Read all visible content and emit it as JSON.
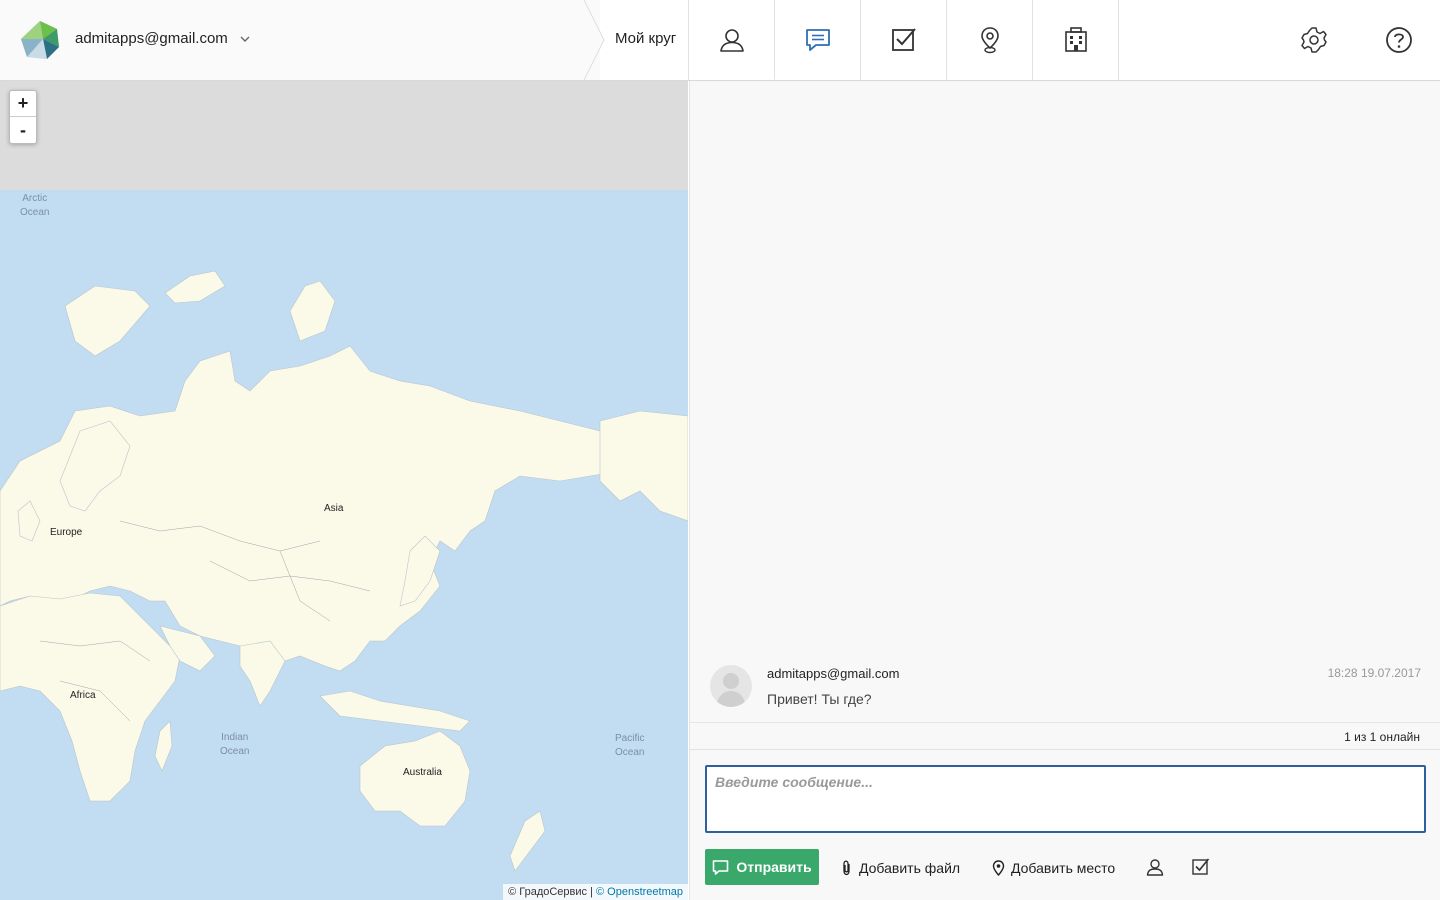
{
  "header": {
    "account_email": "admitapps@gmail.com",
    "breadcrumb": "Мой круг",
    "tabs": [
      {
        "id": "contacts",
        "icon": "user-icon",
        "active": false
      },
      {
        "id": "chat",
        "icon": "chat-icon",
        "active": true
      },
      {
        "id": "tasks",
        "icon": "checkbox-icon",
        "active": false
      },
      {
        "id": "places",
        "icon": "map-pin-icon",
        "active": false
      },
      {
        "id": "organizations",
        "icon": "building-icon",
        "active": false
      }
    ],
    "settings_icon": "gear-icon",
    "help_icon": "help-icon"
  },
  "map": {
    "zoom_in": "+",
    "zoom_out": "-",
    "labels": {
      "asia": "Asia",
      "europe": "Europe",
      "africa": "Africa",
      "australia": "Australia"
    },
    "oceans": {
      "arctic_1": "Arctic",
      "arctic_2": "Ocean",
      "indian_1": "Indian",
      "indian_2": "Ocean",
      "pacific_1": "Pacific",
      "pacific_2": "Ocean"
    },
    "attribution_text": "© ГрадоСервис | ",
    "attribution_link": "© Openstreetmap"
  },
  "chat": {
    "messages": [
      {
        "author": "admitapps@gmail.com",
        "time": "18:28 19.07.2017",
        "text": "Привет! Ты где?"
      }
    ],
    "online_status": "1 из 1 онлайн",
    "composer_placeholder": "Введите сообщение...",
    "send_label": "Отправить",
    "add_file_label": "Добавить файл",
    "add_place_label": "Добавить место"
  },
  "colors": {
    "accent_blue": "#2f6fb5",
    "send_green": "#3aa86b",
    "ocean": "#c2dcf1",
    "land": "#fbf9e8"
  }
}
